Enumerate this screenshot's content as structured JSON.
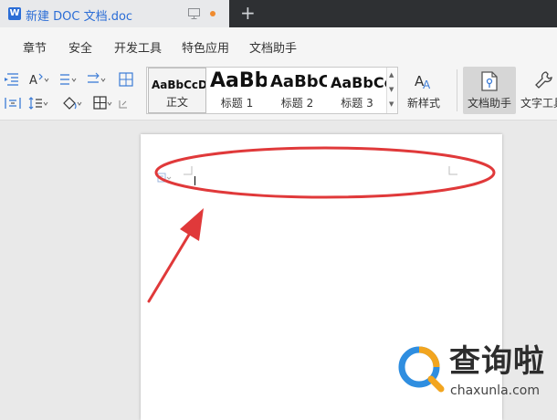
{
  "window": {
    "doc_tab_title": "新建 DOC 文档.doc",
    "doc_icon_letter": "W",
    "new_tab_symbol": "+"
  },
  "menu": {
    "items": [
      "章节",
      "安全",
      "开发工具",
      "特色应用",
      "文档助手"
    ]
  },
  "ribbon": {
    "styles": [
      {
        "sample": "AaBbCcDd",
        "label": "正文"
      },
      {
        "sample": "AaBb",
        "label": "标题 1"
      },
      {
        "sample": "AaBbC",
        "label": "标题 2"
      },
      {
        "sample": "AaBbCc",
        "label": "标题 3"
      }
    ],
    "new_style_label": "新样式",
    "doc_helper_label": "文档助手",
    "text_tools_label": "文字工具"
  },
  "colors": {
    "accent_blue": "#2b6dd6",
    "annotation_red": "#e0393a",
    "modified_dot": "#f08b2f"
  },
  "watermark": {
    "brand": "查询啦",
    "url": "chaxunla.com"
  }
}
